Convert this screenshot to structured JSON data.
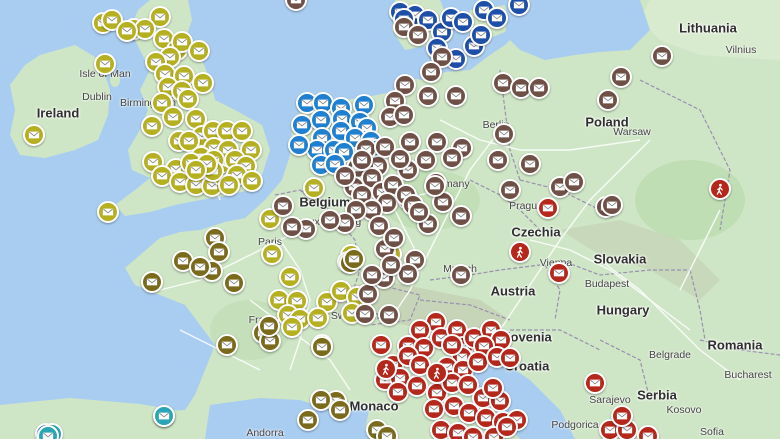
{
  "map": {
    "colors": {
      "water": "#a9cdf0",
      "land": "#cfe6c6",
      "land_north": "#d9ebcf",
      "forest": "#b6d8a8",
      "mountain": "#c3d1b4",
      "road": "#ffffff",
      "border": "#9a8fb0",
      "marker_yellow": "#b5b020",
      "marker_olive": "#7a6a1c",
      "marker_blue": "#1f7fd0",
      "marker_navy": "#1d4ea8",
      "marker_brown": "#6f5047",
      "marker_red": "#b5271b",
      "marker_teal": "#2aa5b5"
    },
    "labels": {
      "countries": [
        {
          "name": "Lithuania"
        },
        {
          "name": "Ireland"
        },
        {
          "name": "Poland"
        },
        {
          "name": "Belgium"
        },
        {
          "name": "Czechia"
        },
        {
          "name": "Slovakia"
        },
        {
          "name": "Austria"
        },
        {
          "name": "Hungary"
        },
        {
          "name": "Romania"
        },
        {
          "name": "Serbia"
        },
        {
          "name": "Monaco"
        },
        {
          "name": "Croatia"
        },
        {
          "name": "Slovenia"
        }
      ],
      "cities": [
        {
          "name": "Vilnius"
        },
        {
          "name": "Dublin"
        },
        {
          "name": "Isle of Man"
        },
        {
          "name": "Warsaw"
        },
        {
          "name": "Prague"
        },
        {
          "name": "Munich"
        },
        {
          "name": "Vienna"
        },
        {
          "name": "Budapest"
        },
        {
          "name": "Belgrade"
        },
        {
          "name": "Bucharest"
        },
        {
          "name": "Sarajevo"
        },
        {
          "name": "Kosovo"
        },
        {
          "name": "Berlin"
        },
        {
          "name": "Birmingham"
        },
        {
          "name": "Paris"
        },
        {
          "name": "Luxembourg"
        },
        {
          "name": "Germany"
        },
        {
          "name": "France"
        },
        {
          "name": "Switzerland"
        },
        {
          "name": "Andorra"
        },
        {
          "name": "Podgorica"
        },
        {
          "name": "Sofia"
        }
      ]
    },
    "markers": {
      "yellow": {
        "icon": "envelope-icon",
        "count": 70
      },
      "olive": {
        "icon": "envelope-icon",
        "count": 20
      },
      "blue": {
        "icon": "envelope-icon",
        "count": 22
      },
      "navy": {
        "icon": "envelope-icon",
        "count": 14
      },
      "brown": {
        "icon": "envelope-icon",
        "count": 70
      },
      "red": {
        "icon": "envelope-icon",
        "count": 50
      },
      "red_hiking": {
        "icon": "hiker-icon",
        "count": 4
      },
      "teal": {
        "icon": "envelope-icon",
        "count": 3
      }
    }
  }
}
